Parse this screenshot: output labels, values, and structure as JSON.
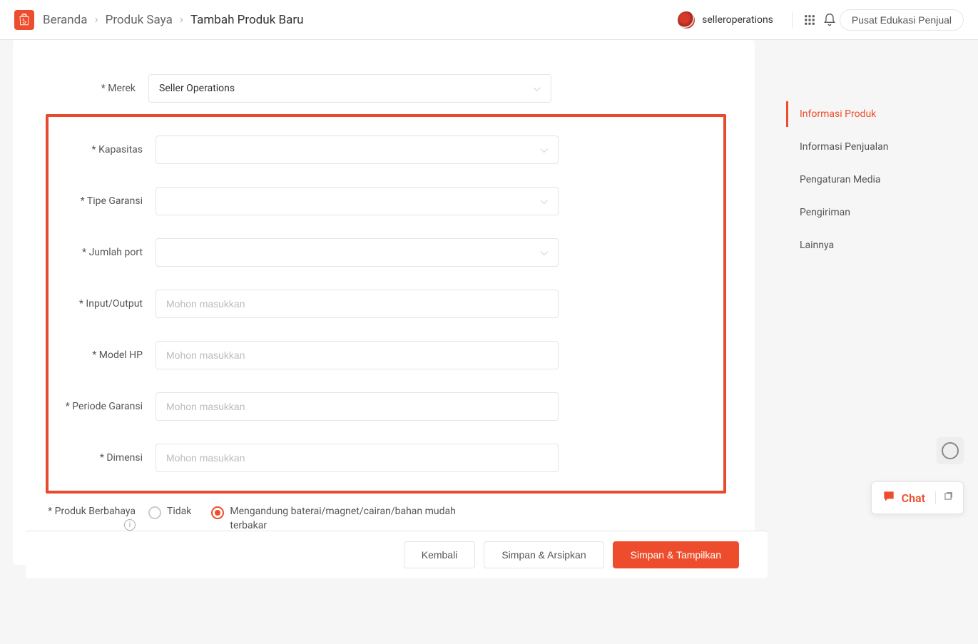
{
  "breadcrumb": {
    "home": "Beranda",
    "mid": "Produk Saya",
    "current": "Tambah Produk Baru"
  },
  "user": {
    "name": "selleroperations"
  },
  "edu_button": "Pusat Edukasi Penjual",
  "form": {
    "brand": {
      "label": "Merek",
      "value": "Seller Operations"
    },
    "capacity": {
      "label": "Kapasitas",
      "value": ""
    },
    "warranty_type": {
      "label": "Tipe Garansi",
      "value": ""
    },
    "port_count": {
      "label": "Jumlah port",
      "value": ""
    },
    "io": {
      "label": "Input/Output",
      "placeholder": "Mohon masukkan",
      "value": ""
    },
    "model_hp": {
      "label": "Model HP",
      "placeholder": "Mohon masukkan",
      "value": ""
    },
    "warranty_period": {
      "label": "Periode Garansi",
      "placeholder": "Mohon masukkan",
      "value": ""
    },
    "dimension": {
      "label": "Dimensi",
      "placeholder": "Mohon masukkan",
      "value": ""
    },
    "hazard": {
      "label": "Produk Berbahaya",
      "options": {
        "no": "Tidak",
        "yes": "Mengandung baterai/magnet/cairan/bahan mudah terbakar"
      },
      "selected": "yes"
    }
  },
  "sidenav": {
    "items": [
      {
        "label": "Informasi Produk",
        "active": true
      },
      {
        "label": "Informasi Penjualan",
        "active": false
      },
      {
        "label": "Pengaturan Media",
        "active": false
      },
      {
        "label": "Pengiriman",
        "active": false
      },
      {
        "label": "Lainnya",
        "active": false
      }
    ]
  },
  "footer": {
    "back": "Kembali",
    "save_archive": "Simpan & Arsipkan",
    "save_publish": "Simpan & Tampilkan"
  },
  "chat": {
    "label": "Chat"
  },
  "required_mark": "*"
}
